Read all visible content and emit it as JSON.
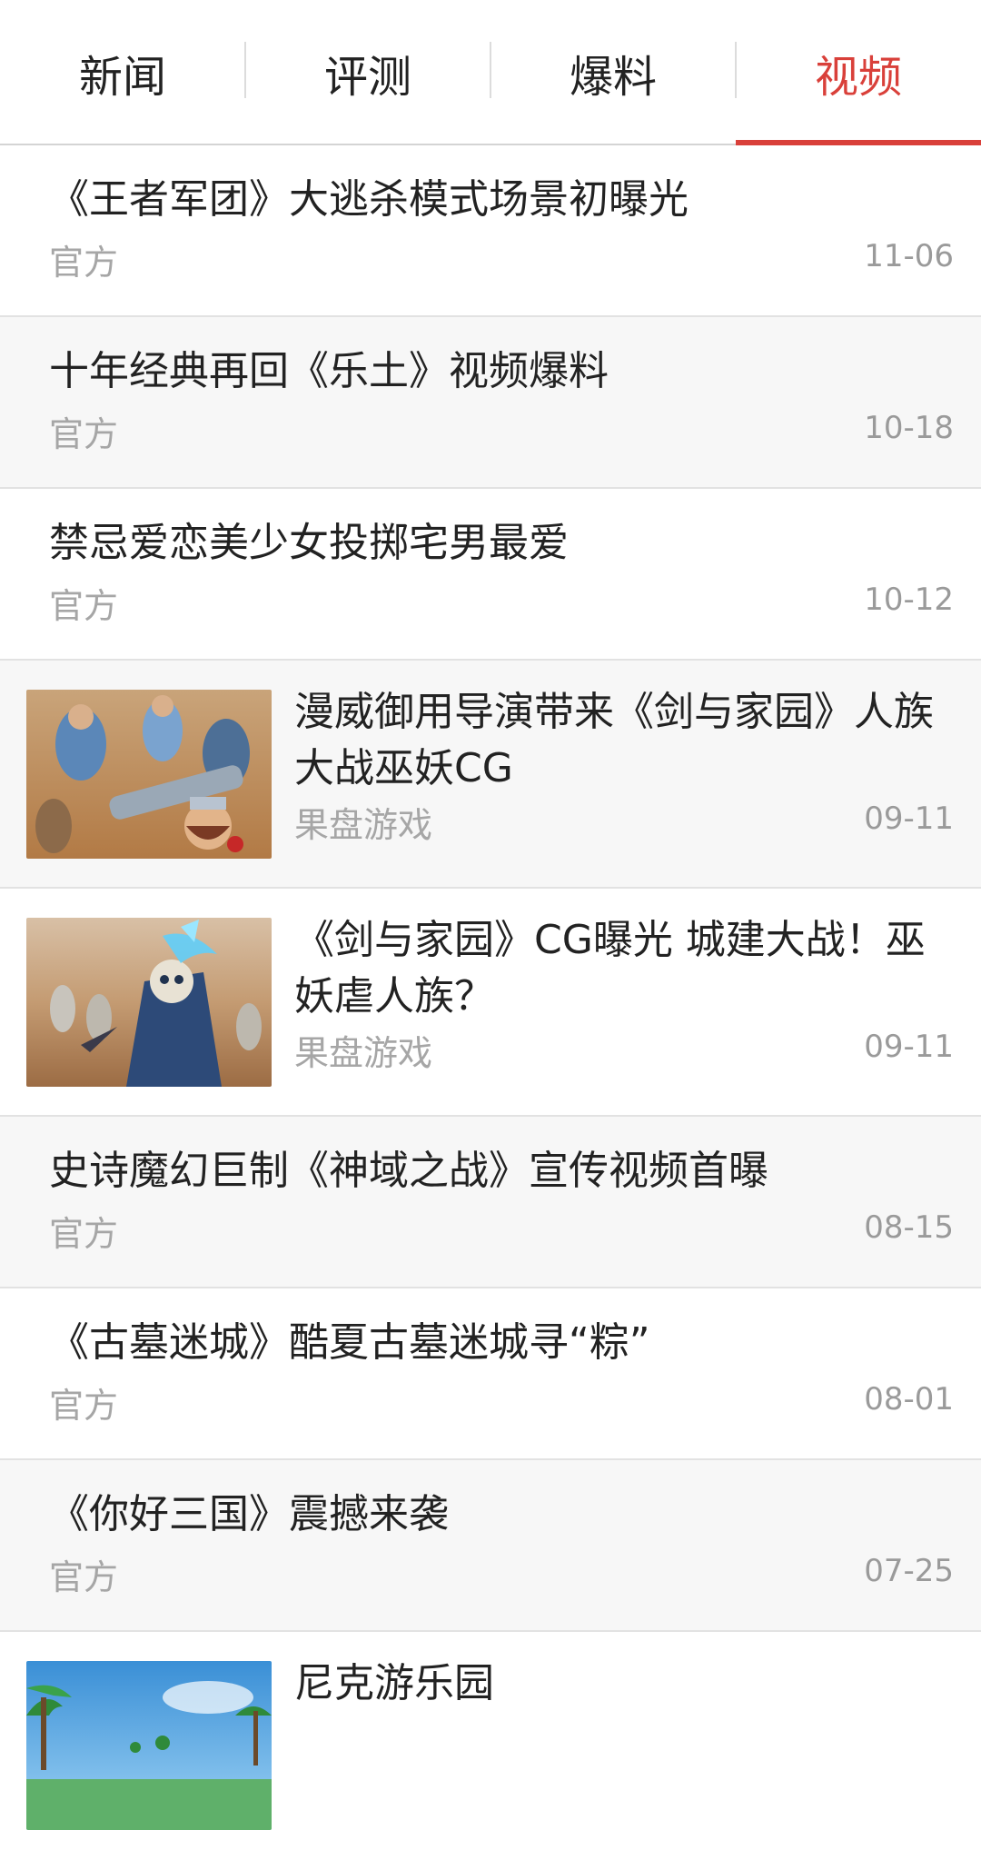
{
  "tabs": [
    {
      "label": "新闻"
    },
    {
      "label": "评测"
    },
    {
      "label": "爆料"
    },
    {
      "label": "视频",
      "active": true
    }
  ],
  "colors": {
    "accent": "#d9403a",
    "text": "#222222",
    "meta": "#a6a6a6",
    "alt_row": "#f7f7f7"
  },
  "items": [
    {
      "title": "《王者军团》大逃杀模式场景初曝光",
      "source": "官方",
      "date": "11-06"
    },
    {
      "title": "十年经典再回《乐土》视频爆料",
      "source": "官方",
      "date": "10-18"
    },
    {
      "title": "禁忌爱恋美少女投掷宅男最爱",
      "source": "官方",
      "date": "10-12"
    },
    {
      "title": "漫威御用导演带来《剑与家园》人族大战巫妖CG",
      "source": "果盘游戏",
      "date": "09-11",
      "thumbnail": "battle-scene-image"
    },
    {
      "title": "《剑与家园》CG曝光 城建大战！巫妖虐人族？",
      "source": "果盘游戏",
      "date": "09-11",
      "thumbnail": "lich-scene-image"
    },
    {
      "title": "史诗魔幻巨制《神域之战》宣传视频首曝",
      "source": "官方",
      "date": "08-15"
    },
    {
      "title": "《古墓迷城》酷夏古墓迷城寻“粽”",
      "source": "官方",
      "date": "08-01"
    },
    {
      "title": "《你好三国》震撼来袭",
      "source": "官方",
      "date": "07-25"
    },
    {
      "title": "尼克游乐园",
      "thumbnail": "park-scene-image"
    }
  ]
}
